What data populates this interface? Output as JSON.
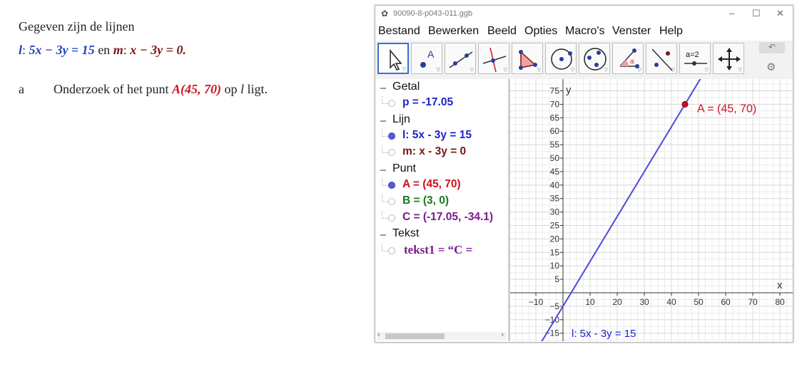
{
  "left": {
    "intro": "Gegeven zijn de lijnen",
    "line_l": {
      "name": "l",
      "colon": ":",
      "equation": "5x − 3y = 15"
    },
    "connector": "en",
    "line_m": {
      "name": "m",
      "colon": ":",
      "equation": "x − 3y = 0."
    },
    "question": {
      "label": "a",
      "text_before": "Onderzoek of het punt",
      "point": "A(45, 70)",
      "text_mid": "op",
      "line_name": "l",
      "text_after": "ligt."
    }
  },
  "window": {
    "title": "90090-8-p043-011.ggb",
    "controls": [
      "–",
      "☐",
      "✕"
    ],
    "menu": [
      "Bestand",
      "Bewerken",
      "Beeld",
      "Opties",
      "Macro's",
      "Venster",
      "Help"
    ],
    "tools": [
      {
        "name": "move-tool-icon",
        "selected": true
      },
      {
        "name": "point-tool-icon"
      },
      {
        "name": "line-tool-icon"
      },
      {
        "name": "perpendicular-line-tool-icon"
      },
      {
        "name": "polygon-tool-icon"
      },
      {
        "name": "circle-tool-icon"
      },
      {
        "name": "circle-three-points-tool-icon"
      },
      {
        "name": "angle-tool-icon"
      },
      {
        "name": "reflect-tool-icon"
      },
      {
        "name": "slider-tool-icon",
        "text": "a = 2"
      },
      {
        "name": "move-graphics-view-tool-icon"
      }
    ]
  },
  "algebra": {
    "categories": [
      {
        "label": "Getal",
        "items": [
          {
            "text": "p = -17.05",
            "color": "#1e24c8",
            "visible": false
          }
        ]
      },
      {
        "label": "Lijn",
        "items": [
          {
            "text": "l: 5x - 3y = 15",
            "color": "#1e24c8",
            "visible": true
          },
          {
            "text": "m: x - 3y = 0",
            "color": "#7a1515",
            "visible": false
          }
        ]
      },
      {
        "label": "Punt",
        "items": [
          {
            "text": "A = (45, 70)",
            "color": "#d10f1f",
            "visible": true
          },
          {
            "text": "B = (3, 0)",
            "color": "#187a18",
            "visible": false
          },
          {
            "text": "C = (-17.05, -34.1)",
            "color": "#7a1a8c",
            "visible": false
          }
        ]
      },
      {
        "label": "Tekst",
        "items": [
          {
            "text": "tekst1 = “C =",
            "color": "#7a1a8c",
            "visible": false
          }
        ]
      }
    ]
  },
  "graph": {
    "x_axis_label": "x",
    "y_axis_label": "y",
    "x_ticks": [
      "−10",
      "10",
      "20",
      "30",
      "40",
      "50",
      "60",
      "70",
      "80"
    ],
    "y_ticks": [
      "75",
      "70",
      "65",
      "60",
      "55",
      "50",
      "45",
      "40",
      "35",
      "30",
      "25",
      "20",
      "15",
      "10",
      "5",
      "−5",
      "−10",
      "−15"
    ],
    "point_label": "A = (45, 70)",
    "line_label": "l: 5x - 3y = 15",
    "point": {
      "x": 45,
      "y": 70
    },
    "line": {
      "a": 5,
      "b": -3,
      "c": 15
    },
    "line_color": "#4b4bd8",
    "point_color": "#d10f1f"
  }
}
